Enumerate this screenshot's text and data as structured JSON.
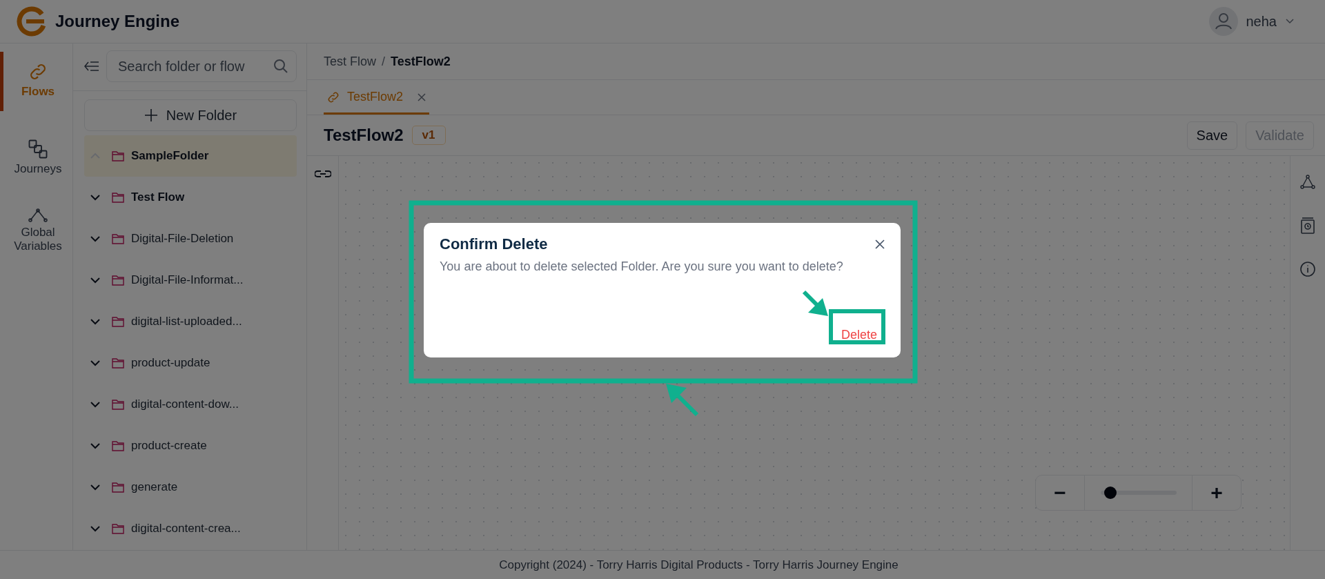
{
  "header": {
    "app_name": "Journey Engine",
    "user": "neha"
  },
  "nav": [
    {
      "label": "Flows",
      "kind": "link",
      "selected": true
    },
    {
      "label": "Journeys",
      "kind": "squares",
      "selected": false
    },
    {
      "label": "Global Variables",
      "kind": "graph",
      "selected": false
    }
  ],
  "folder_panel": {
    "search": {
      "placeholder": "Search folder or flow"
    },
    "new_folder": "New Folder",
    "folders": [
      {
        "name": "SampleFolder",
        "selected": true,
        "expanded": true,
        "bold": true
      },
      {
        "name": "Test Flow",
        "selected": false,
        "expanded": false,
        "bold": true
      },
      {
        "name": "Digital-File-Deletion",
        "selected": false,
        "expanded": false,
        "bold": false
      },
      {
        "name": "Digital-File-Informat...",
        "selected": false,
        "expanded": false,
        "bold": false
      },
      {
        "name": "digital-list-uploaded...",
        "selected": false,
        "expanded": false,
        "bold": false
      },
      {
        "name": "product-update",
        "selected": false,
        "expanded": false,
        "bold": false
      },
      {
        "name": "digital-content-dow...",
        "selected": false,
        "expanded": false,
        "bold": false
      },
      {
        "name": "product-create",
        "selected": false,
        "expanded": false,
        "bold": false
      },
      {
        "name": "generate",
        "selected": false,
        "expanded": false,
        "bold": false
      },
      {
        "name": "digital-content-crea...",
        "selected": false,
        "expanded": false,
        "bold": false
      }
    ]
  },
  "breadcrumb": {
    "items": [
      "Test Flow",
      "TestFlow2"
    ],
    "separator": "/"
  },
  "tabs": [
    {
      "label": "TestFlow2",
      "selected": true
    }
  ],
  "flow": {
    "title": "TestFlow2",
    "version": "v1",
    "buttons": [
      {
        "label": "Save",
        "disabled": false
      },
      {
        "label": "Validate",
        "disabled": true
      }
    ]
  },
  "zoom": {
    "level": 0.13,
    "minus": "−",
    "plus": "+"
  },
  "dialog": {
    "title": "Confirm Delete",
    "message": "You are about to delete selected Folder. Are you sure you want to delete?",
    "confirm": "Delete"
  },
  "footer": "Copyright (2024) - Torry Harris Digital Products - Torry Harris Journey Engine"
}
